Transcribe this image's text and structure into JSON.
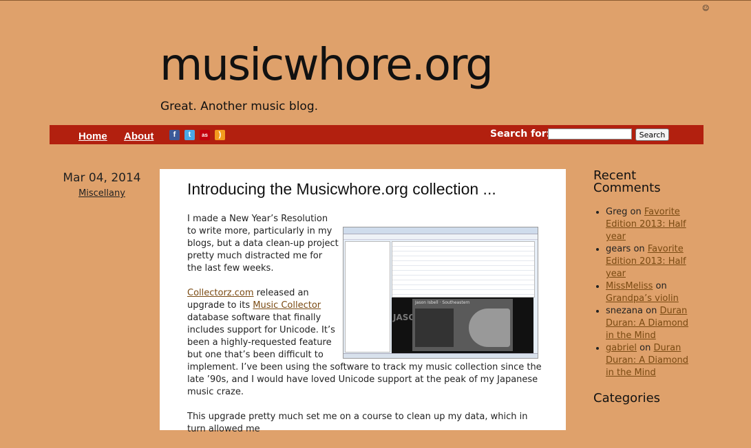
{
  "header": {
    "site_title": "musicwhore.org",
    "tagline": "Great. Another music blog."
  },
  "nav": {
    "items": [
      {
        "label": "Home"
      },
      {
        "label": "About"
      }
    ],
    "social_icons": [
      "facebook-icon",
      "twitter-icon",
      "lastfm-icon",
      "rss-icon"
    ],
    "search_label": "Search for:",
    "search_value": "",
    "search_button": "Search"
  },
  "post": {
    "date": "Mar 04, 2014",
    "category": "Miscellany",
    "title": "Introducing the Musicwhore.org collection ...",
    "p1": "I made a New Year’s Resolution to write more, particularly in my blogs, but a data clean-up project pretty much distracted me for the last few weeks.",
    "p2_link1": "Collectorz.com",
    "p2_text1": " released an upgrade to its ",
    "p2_link2": "Music Collector",
    "p2_text2": " database software that finally includes support for Unicode. It’s been a highly-requested feature but one that’s been difficult to implement. I’ve been using the software to track my music collection since the late ’90s, and I would have loved Unicode support at the peak of my Japanese music craze.",
    "p3": "This upgrade pretty much set me on a course to clean up my data, which in turn allowed me",
    "screenshot": {
      "artist_album": "Jason Isbell · Southeastern",
      "cover_text": "JASO SOUTH"
    }
  },
  "sidebar": {
    "recent_comments_title": "Recent Comments",
    "comments": [
      {
        "author": "Greg",
        "author_link": false,
        "on": " on ",
        "post": "Favorite Edition 2013: Half year"
      },
      {
        "author": "gears",
        "author_link": false,
        "on": " on ",
        "post": "Favorite Edition 2013: Half year"
      },
      {
        "author": "MissMeliss",
        "author_link": true,
        "on": " on ",
        "post": "Grandpa’s violin"
      },
      {
        "author": "snezana",
        "author_link": false,
        "on": " on ",
        "post": "Duran Duran: A Diamond in the Mind"
      },
      {
        "author": "gabriel",
        "author_link": true,
        "on": " on ",
        "post": "Duran Duran: A Diamond in the Mind"
      }
    ],
    "categories_title": "Categories"
  },
  "colors": {
    "page_bg": "#dfa16b",
    "nav_bg": "#b2200f",
    "link": "#7a4a12"
  }
}
